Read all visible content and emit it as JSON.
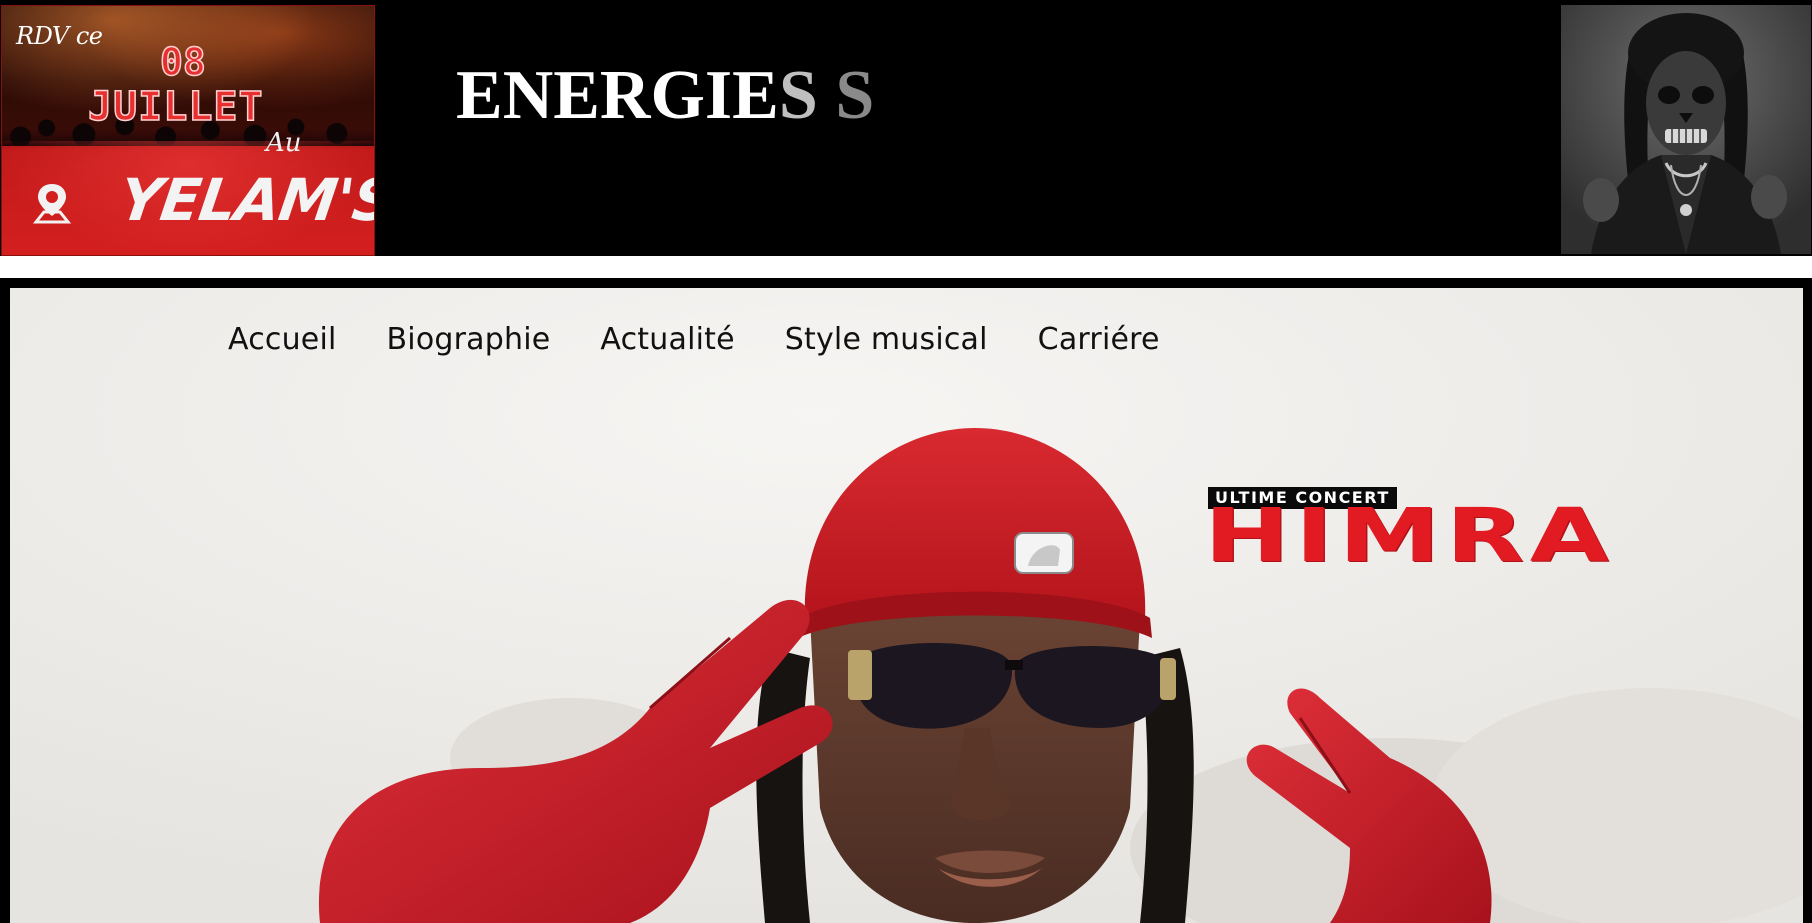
{
  "banner": {
    "promo": {
      "intro": "RDV ce",
      "day": "08",
      "month": "JUILLET",
      "preposition": "Au",
      "venue": "YELAM'S",
      "location_icon": "map-pin-icon"
    },
    "title_bright": "ENERGIE",
    "title_faded_1": "S",
    "title_faded_2": " S"
  },
  "nav": {
    "items": [
      {
        "label": "Accueil"
      },
      {
        "label": "Biographie"
      },
      {
        "label": "Actualité"
      },
      {
        "label": "Style musical"
      },
      {
        "label": "Carriére"
      }
    ]
  },
  "hero": {
    "concert_tag": "ULTIME CONCERT",
    "concert_name": "HIMRA",
    "accent_color": "#e21a22"
  }
}
